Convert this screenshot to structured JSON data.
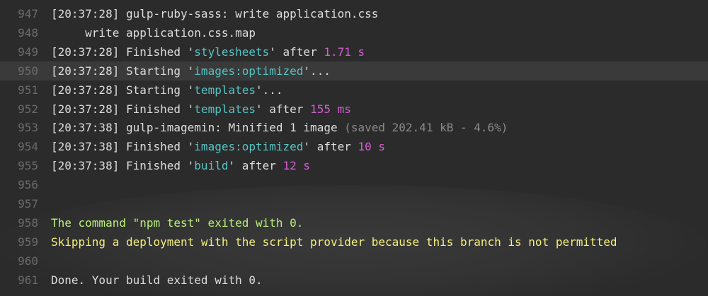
{
  "colors": {
    "background": "#2b2b2b",
    "highlight": "#3a3a3a",
    "line_number": "#6b6b6b",
    "text": "#dddddd",
    "cyan": "#56c4c4",
    "magenta": "#d35fd3",
    "gray": "#8a8a8a",
    "green": "#b9f07a",
    "yellow": "#f3f07e"
  },
  "lines": [
    {
      "number": "947",
      "segments": [
        {
          "text": "[20:37:28] ",
          "color": "text"
        },
        {
          "text": "gulp-ruby-sass: write application.css",
          "color": "text"
        }
      ]
    },
    {
      "number": "948",
      "segments": [
        {
          "text": "     write application.css.map",
          "color": "text"
        }
      ]
    },
    {
      "number": "949",
      "segments": [
        {
          "text": "[20:37:28] ",
          "color": "text"
        },
        {
          "text": "Finished '",
          "color": "text"
        },
        {
          "text": "stylesheets",
          "color": "cyan"
        },
        {
          "text": "' after ",
          "color": "text"
        },
        {
          "text": "1.71 s",
          "color": "magenta"
        }
      ]
    },
    {
      "number": "950",
      "highlighted": true,
      "segments": [
        {
          "text": "[20:37:28] ",
          "color": "text"
        },
        {
          "text": "Starting '",
          "color": "text"
        },
        {
          "text": "images:optimized",
          "color": "cyan"
        },
        {
          "text": "'...",
          "color": "text"
        }
      ]
    },
    {
      "number": "951",
      "segments": [
        {
          "text": "[20:37:28] ",
          "color": "text"
        },
        {
          "text": "Starting '",
          "color": "text"
        },
        {
          "text": "templates",
          "color": "cyan"
        },
        {
          "text": "'...",
          "color": "text"
        }
      ]
    },
    {
      "number": "952",
      "segments": [
        {
          "text": "[20:37:28] ",
          "color": "text"
        },
        {
          "text": "Finished '",
          "color": "text"
        },
        {
          "text": "templates",
          "color": "cyan"
        },
        {
          "text": "' after ",
          "color": "text"
        },
        {
          "text": "155 ms",
          "color": "magenta"
        }
      ]
    },
    {
      "number": "953",
      "segments": [
        {
          "text": "[20:37:38] ",
          "color": "text"
        },
        {
          "text": "gulp-imagemin: Minified 1 image ",
          "color": "text"
        },
        {
          "text": "(saved 202.41 kB - 4.6%)",
          "color": "gray"
        }
      ]
    },
    {
      "number": "954",
      "segments": [
        {
          "text": "[20:37:38] ",
          "color": "text"
        },
        {
          "text": "Finished '",
          "color": "text"
        },
        {
          "text": "images:optimized",
          "color": "cyan"
        },
        {
          "text": "' after ",
          "color": "text"
        },
        {
          "text": "10 s",
          "color": "magenta"
        }
      ]
    },
    {
      "number": "955",
      "segments": [
        {
          "text": "[20:37:38] ",
          "color": "text"
        },
        {
          "text": "Finished '",
          "color": "text"
        },
        {
          "text": "build",
          "color": "cyan"
        },
        {
          "text": "' after ",
          "color": "text"
        },
        {
          "text": "12 s",
          "color": "magenta"
        }
      ]
    },
    {
      "number": "956",
      "segments": []
    },
    {
      "number": "957",
      "segments": []
    },
    {
      "number": "958",
      "segments": [
        {
          "text": "The command \"npm test\" exited with 0.",
          "color": "green"
        }
      ]
    },
    {
      "number": "959",
      "segments": [
        {
          "text": "Skipping a deployment with the script provider because this branch is not permitted",
          "color": "yellow"
        }
      ]
    },
    {
      "number": "960",
      "segments": []
    },
    {
      "number": "961",
      "segments": [
        {
          "text": "Done. Your build exited with 0.",
          "color": "text"
        }
      ]
    }
  ]
}
